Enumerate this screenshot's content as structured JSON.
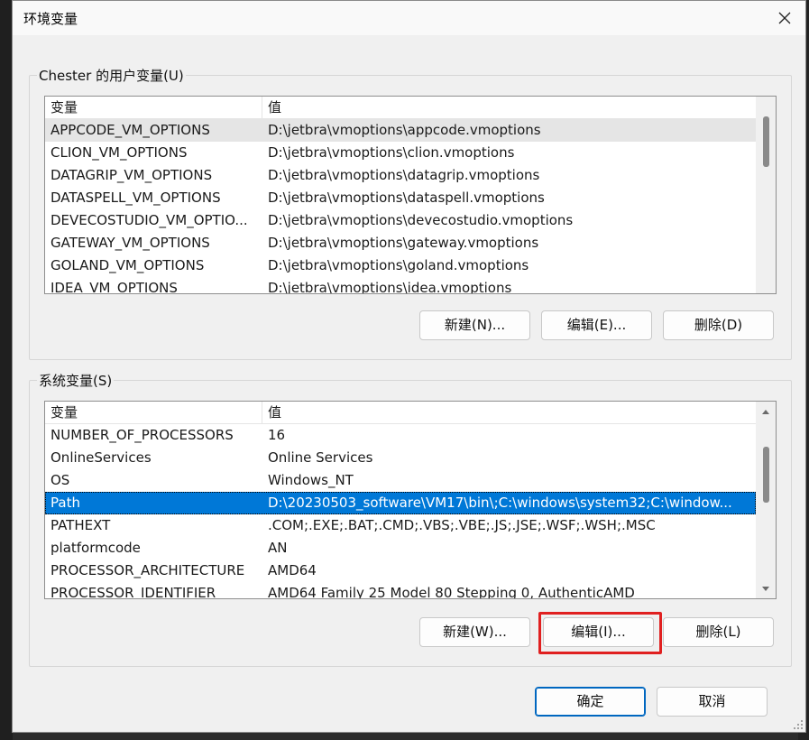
{
  "window": {
    "title": "环境变量",
    "close_icon": "close-icon"
  },
  "user_vars": {
    "label": "Chester 的用户变量(U)",
    "columns": [
      "变量",
      "值"
    ],
    "rows": [
      {
        "name": "APPCODE_VM_OPTIONS",
        "value": "D:\\jetbra\\vmoptions\\appcode.vmoptions"
      },
      {
        "name": "CLION_VM_OPTIONS",
        "value": "D:\\jetbra\\vmoptions\\clion.vmoptions"
      },
      {
        "name": "DATAGRIP_VM_OPTIONS",
        "value": "D:\\jetbra\\vmoptions\\datagrip.vmoptions"
      },
      {
        "name": "DATASPELL_VM_OPTIONS",
        "value": "D:\\jetbra\\vmoptions\\dataspell.vmoptions"
      },
      {
        "name": "DEVECOSTUDIO_VM_OPTIO...",
        "value": "D:\\jetbra\\vmoptions\\devecostudio.vmoptions"
      },
      {
        "name": "GATEWAY_VM_OPTIONS",
        "value": "D:\\jetbra\\vmoptions\\gateway.vmoptions"
      },
      {
        "name": "GOLAND_VM_OPTIONS",
        "value": "D:\\jetbra\\vmoptions\\goland.vmoptions"
      },
      {
        "name": "IDEA_VM_OPTIONS",
        "value": "D:\\jetbra\\vmoptions\\idea.vmoptions"
      }
    ],
    "buttons": {
      "new": "新建(N)...",
      "edit": "编辑(E)...",
      "delete": "删除(D)"
    }
  },
  "system_vars": {
    "label": "系统变量(S)",
    "columns": [
      "变量",
      "值"
    ],
    "rows": [
      {
        "name": "NUMBER_OF_PROCESSORS",
        "value": "16"
      },
      {
        "name": "OnlineServices",
        "value": "Online Services"
      },
      {
        "name": "OS",
        "value": "Windows_NT"
      },
      {
        "name": "Path",
        "value": "D:\\20230503_software\\VM17\\bin\\;C:\\windows\\system32;C:\\window..."
      },
      {
        "name": "PATHEXT",
        "value": ".COM;.EXE;.BAT;.CMD;.VBS;.VBE;.JS;.JSE;.WSF;.WSH;.MSC"
      },
      {
        "name": "platformcode",
        "value": "AN"
      },
      {
        "name": "PROCESSOR_ARCHITECTURE",
        "value": "AMD64"
      },
      {
        "name": "PROCESSOR_IDENTIFIER",
        "value": "AMD64 Family 25 Model 80 Stepping 0, AuthenticAMD"
      }
    ],
    "buttons": {
      "new": "新建(W)...",
      "edit": "编辑(I)...",
      "delete": "删除(L)"
    }
  },
  "footer": {
    "ok": "确定",
    "cancel": "取消"
  },
  "colors": {
    "selection": "#0078d7",
    "highlight": "#e02020"
  }
}
